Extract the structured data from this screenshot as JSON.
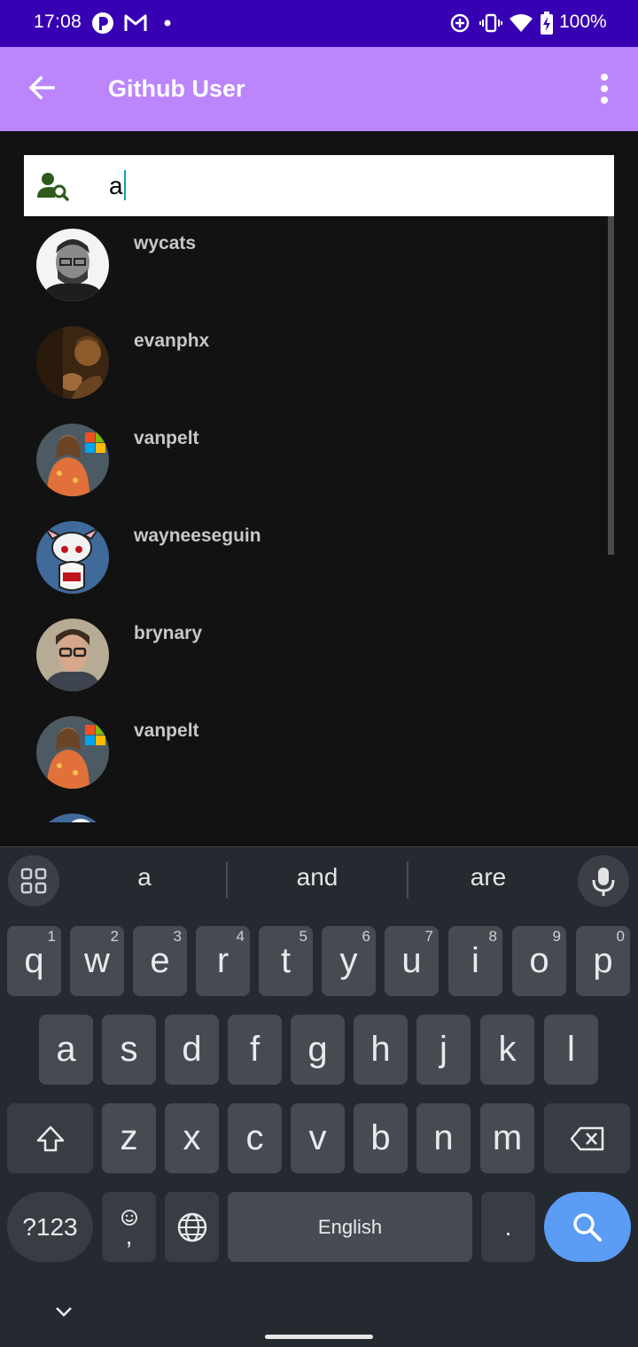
{
  "status_bar": {
    "time": "17:08",
    "battery": "100%",
    "icons": [
      "notification-app-icon",
      "gmail-icon",
      "dot-icon",
      "data-saver-icon",
      "vibrate-icon",
      "wifi-icon",
      "battery-charging-icon"
    ]
  },
  "app_bar": {
    "title": "Github User",
    "back_icon": "arrow-back-icon",
    "more_icon": "more-vert-icon"
  },
  "search": {
    "value": "a",
    "icon": "person-search-icon"
  },
  "users": [
    {
      "login": "wycats"
    },
    {
      "login": "evanphx"
    },
    {
      "login": "vanpelt"
    },
    {
      "login": "wayneeseguin"
    },
    {
      "login": "brynary"
    },
    {
      "login": "vanpelt"
    },
    {
      "login": ""
    }
  ],
  "keyboard": {
    "suggestions": [
      "a",
      "and",
      "are"
    ],
    "row1": [
      [
        "q",
        "1"
      ],
      [
        "w",
        "2"
      ],
      [
        "e",
        "3"
      ],
      [
        "r",
        "4"
      ],
      [
        "t",
        "5"
      ],
      [
        "y",
        "6"
      ],
      [
        "u",
        "7"
      ],
      [
        "i",
        "8"
      ],
      [
        "o",
        "9"
      ],
      [
        "p",
        "0"
      ]
    ],
    "row2": [
      "a",
      "s",
      "d",
      "f",
      "g",
      "h",
      "j",
      "k",
      "l"
    ],
    "row3": [
      "z",
      "x",
      "c",
      "v",
      "b",
      "n",
      "m"
    ],
    "symbols_label": "?123",
    "emoji_comma": ",",
    "space_label": "English",
    "period": ".",
    "colors": {
      "background": "#252a30",
      "key": "#464b52",
      "action": "#5b9cf5"
    }
  },
  "colors": {
    "status_bar": "#3700b3",
    "app_bar": "#bb86fc",
    "background": "#121212",
    "username": "#c7c7c7"
  }
}
